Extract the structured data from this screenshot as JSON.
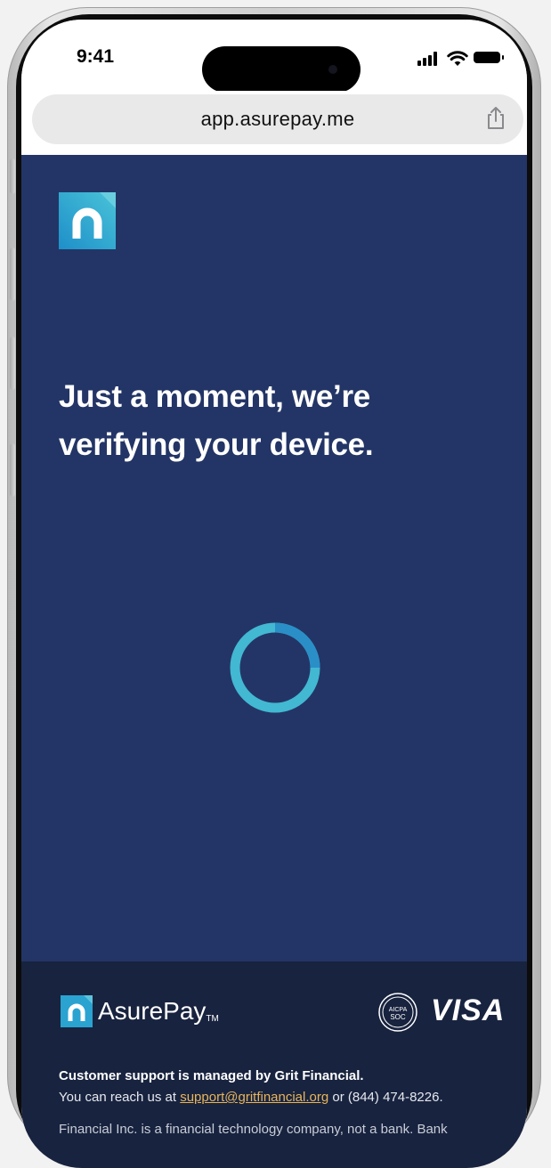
{
  "status_bar": {
    "time": "9:41"
  },
  "browser": {
    "url": "app.asurepay.me",
    "share_icon": "share-icon"
  },
  "page": {
    "logo_icon": "asurepay-logo-icon",
    "headline_line1": "Just a moment, we’re",
    "headline_line2": "verifying your device.",
    "loading_indicator": "spinner"
  },
  "footer": {
    "brand_name": "AsurePay",
    "brand_tm": "TM",
    "badge_line1": "AICPA",
    "badge_line2": "SOC",
    "visa_label": "VISA",
    "support_title": "Customer support is managed by Grit Financial.",
    "support_prefix": "You can reach us at",
    "support_email": "support@gritfinancial.org",
    "support_suffix": "or (844) 474-8226.",
    "disclaimer": "Financial Inc. is a financial technology company, not a bank. Bank"
  },
  "colors": {
    "content_bg": "#233566",
    "footer_bg": "#18233f",
    "spinner": "#3fb4cf",
    "link": "#e8b55a"
  }
}
